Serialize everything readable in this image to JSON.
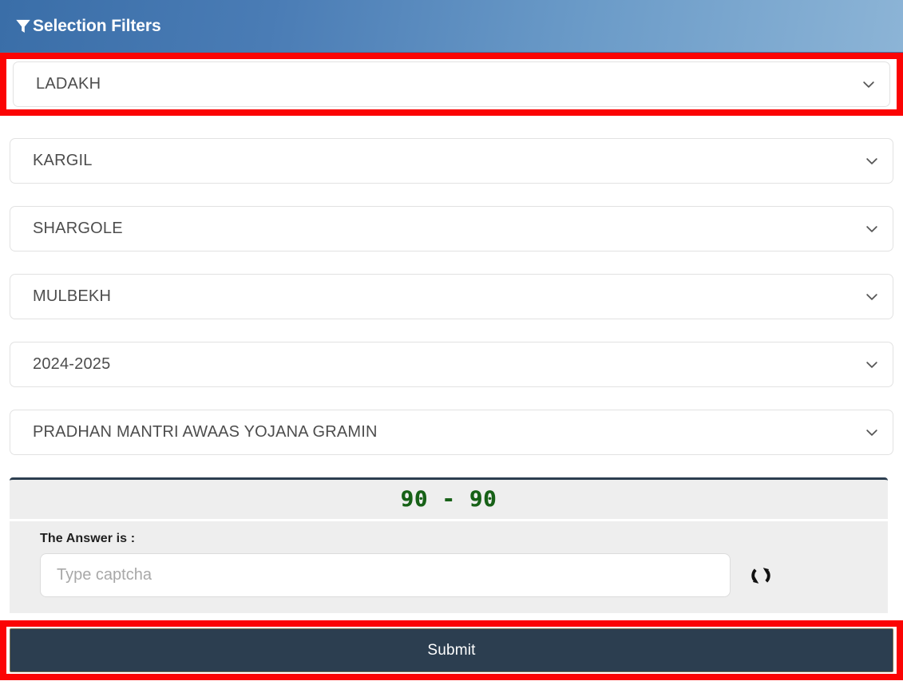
{
  "header": {
    "title": "Selection Filters",
    "icon": "filter-icon",
    "gradient_from": "#3a6ea8",
    "gradient_to": "#8cb4d6"
  },
  "highlight": {
    "color": "#fb0404"
  },
  "filters": [
    {
      "name": "state",
      "value": "LADAKH",
      "highlighted": true
    },
    {
      "name": "district",
      "value": "KARGIL",
      "highlighted": false
    },
    {
      "name": "block",
      "value": "SHARGOLE",
      "highlighted": false
    },
    {
      "name": "panchayat",
      "value": "MULBEKH",
      "highlighted": false
    },
    {
      "name": "financial-year",
      "value": "2024-2025",
      "highlighted": false
    },
    {
      "name": "scheme",
      "value": "PRADHAN MANTRI AWAAS YOJANA GRAMIN",
      "highlighted": false
    }
  ],
  "captcha": {
    "challenge": "90 - 90",
    "challenge_color": "#176117",
    "answer_label": "The Answer is :",
    "input_value": "",
    "input_placeholder": "Type captcha",
    "refresh_icon": "refresh-icon"
  },
  "submit": {
    "label": "Submit",
    "bg_color": "#2c3e50",
    "highlighted": true
  }
}
